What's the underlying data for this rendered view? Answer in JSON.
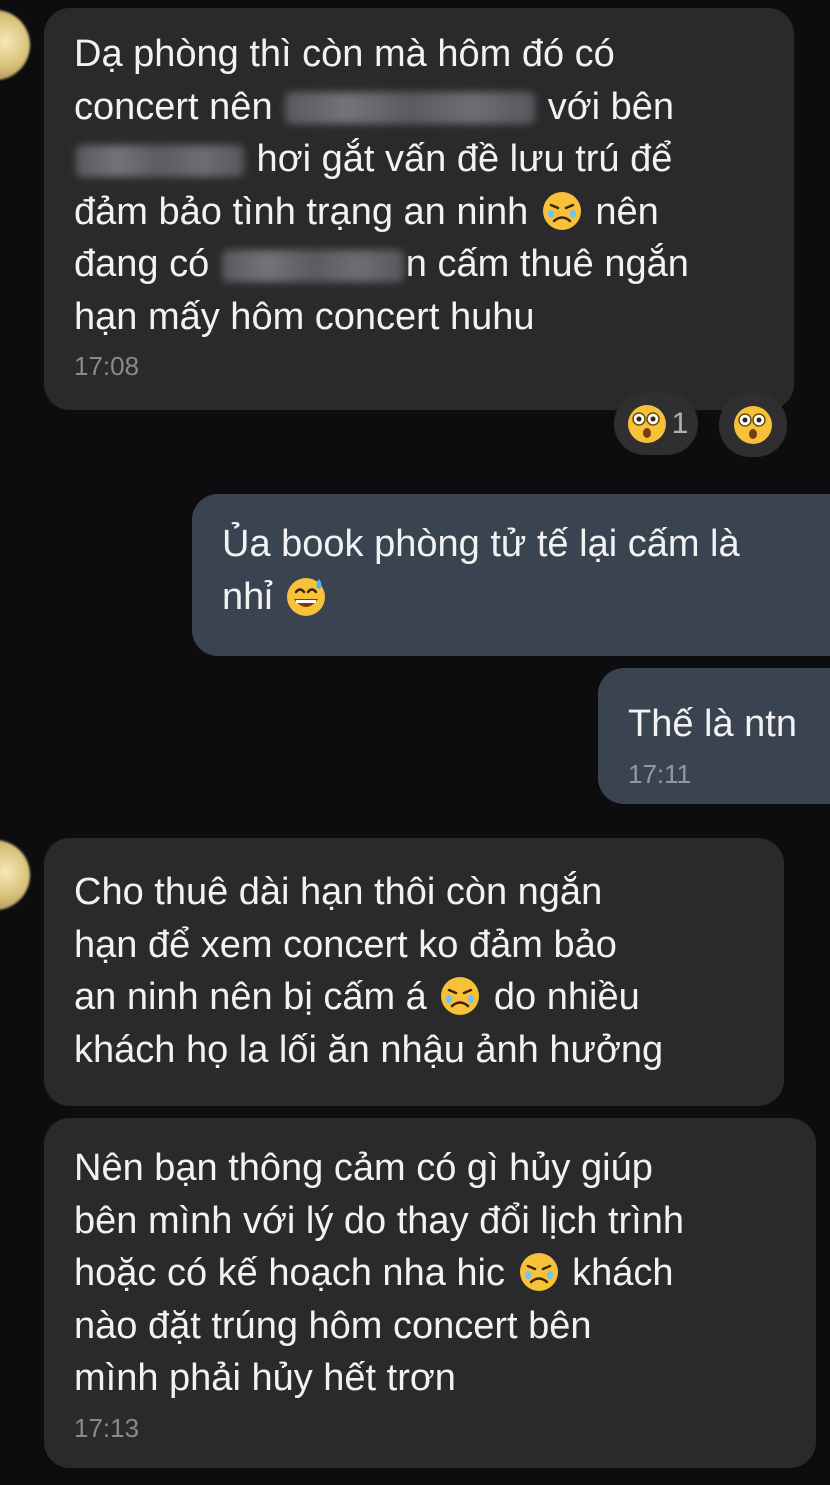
{
  "messages": [
    {
      "direction": "incoming",
      "segments": [
        [
          {
            "t": "Dạ phòng thì còn mà hôm đó có"
          }
        ],
        [
          {
            "t": "concert nên "
          },
          {
            "blur": "ban quản lý",
            "w": 250
          },
          {
            "t": " với bên"
          }
        ],
        [
          {
            "blur": "công an",
            "w": 168
          },
          {
            "t": " hơi gắt vấn đề lưu trú để"
          }
        ],
        [
          {
            "t": "đảm bảo tình trạng an ninh "
          },
          {
            "emoji": "crying-face-icon"
          },
          {
            "t": " nên"
          }
        ],
        [
          {
            "t": "đang có "
          },
          {
            "blur": "công văn",
            "w": 182
          },
          {
            "t": "n cấm thuê ngắn"
          }
        ],
        [
          {
            "t": "hạn mấy hôm concert huhu"
          }
        ]
      ],
      "time": "17:08",
      "reactions": [
        {
          "emoji": "astonished-face-icon",
          "count": "1"
        },
        {
          "emoji": "astonished-face-icon",
          "count": ""
        }
      ]
    },
    {
      "direction": "outgoing",
      "segments": [
        [
          {
            "t": "Ủa book phòng tử tế lại cấm là"
          }
        ],
        [
          {
            "t": "nhỉ "
          },
          {
            "emoji": "grinning-sweat-face-icon"
          }
        ]
      ],
      "time": ""
    },
    {
      "direction": "outgoing",
      "segments": [
        [
          {
            "t": "Thế là ntn"
          }
        ]
      ],
      "time": "17:11"
    },
    {
      "direction": "incoming",
      "segments": [
        [
          {
            "t": "Cho thuê dài hạn thôi còn ngắn"
          }
        ],
        [
          {
            "t": "hạn để xem concert ko đảm bảo"
          }
        ],
        [
          {
            "t": "an ninh nên bị cấm á "
          },
          {
            "emoji": "crying-face-icon"
          },
          {
            "t": " do nhiều"
          }
        ],
        [
          {
            "t": "khách họ la lối ăn nhậu ảnh hưởng"
          }
        ]
      ],
      "time": ""
    },
    {
      "direction": "incoming",
      "segments": [
        [
          {
            "t": "Nên bạn thông cảm có gì hủy giúp"
          }
        ],
        [
          {
            "t": "bên mình với lý do thay đổi lịch trình"
          }
        ],
        [
          {
            "t": "hoặc có kế hoạch nha hic "
          },
          {
            "emoji": "crying-face-icon"
          },
          {
            "t": " khách"
          }
        ],
        [
          {
            "t": "nào đặt trúng hôm concert bên"
          }
        ],
        [
          {
            "t": "mình phải hủy hết trơn"
          }
        ]
      ],
      "time": "17:13"
    }
  ]
}
